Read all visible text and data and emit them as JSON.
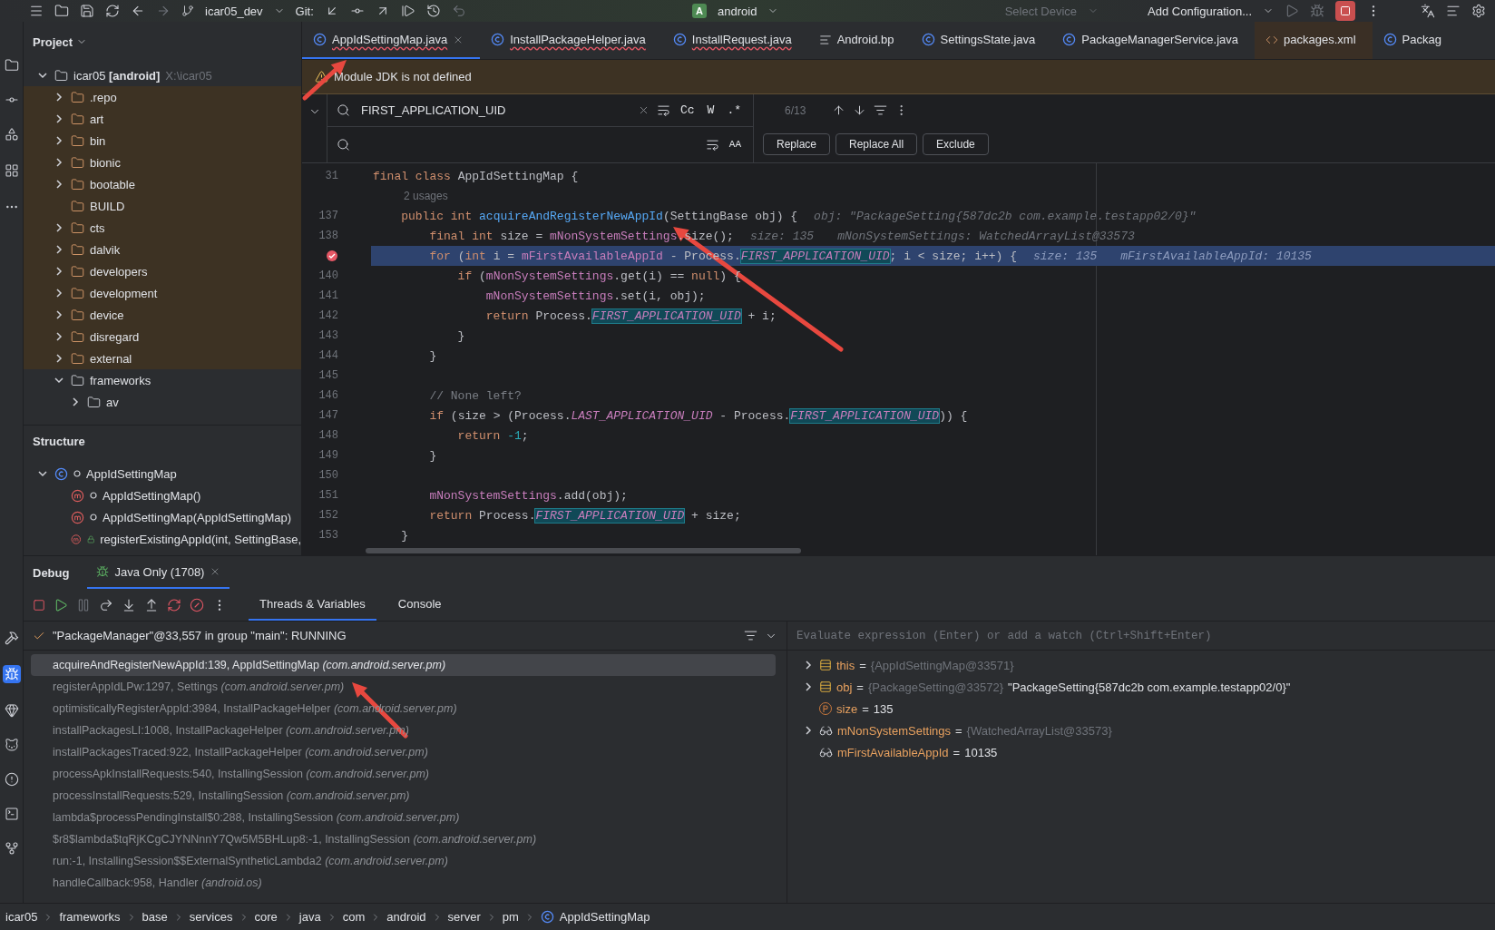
{
  "toolbar": {
    "branch": "icar05_dev",
    "vcs_label": "Git:",
    "project_badge": "A",
    "project": "android",
    "device": {
      "label": "Select Device",
      "disabled": true
    },
    "run_config": "Add Configuration..."
  },
  "project_panel": {
    "title": "Project",
    "root": {
      "label": "icar05 **[android]**",
      "path": "X:\\icar05",
      "expanded": true,
      "children": [
        {
          "label": ".repo",
          "expanded": false,
          "leaf": false,
          "highlighted": true
        },
        {
          "label": "art",
          "expanded": false,
          "leaf": false,
          "highlighted": true
        },
        {
          "label": "bin",
          "expanded": false,
          "leaf": false,
          "highlighted": true
        },
        {
          "label": "bionic",
          "expanded": false,
          "leaf": false,
          "highlighted": true
        },
        {
          "label": "bootable",
          "expanded": false,
          "leaf": false,
          "highlighted": true
        },
        {
          "label": "BUILD",
          "expanded": false,
          "leaf": true,
          "highlighted": true
        },
        {
          "label": "cts",
          "expanded": false,
          "leaf": false,
          "highlighted": true
        },
        {
          "label": "dalvik",
          "expanded": false,
          "leaf": false,
          "highlighted": true
        },
        {
          "label": "developers",
          "expanded": false,
          "leaf": false,
          "highlighted": true
        },
        {
          "label": "development",
          "expanded": false,
          "leaf": false,
          "highlighted": true
        },
        {
          "label": "device",
          "expanded": false,
          "leaf": false,
          "highlighted": true
        },
        {
          "label": "disregard",
          "expanded": false,
          "leaf": false,
          "highlighted": true
        },
        {
          "label": "external",
          "expanded": false,
          "leaf": false,
          "highlighted": true
        },
        {
          "label": "frameworks",
          "expanded": true,
          "leaf": false,
          "highlighted": false,
          "children": [
            {
              "label": "av",
              "expanded": false,
              "leaf": false,
              "highlighted": false
            }
          ]
        }
      ]
    }
  },
  "structure_panel": {
    "title": "Structure",
    "root": {
      "label": "AppIdSettingMap",
      "expanded": true,
      "children": [
        {
          "label": "AppIdSettingMap()",
          "kind": "package_method"
        },
        {
          "label": "AppIdSettingMap(AppIdSettingMap)",
          "kind": "package_method"
        },
        {
          "label": "registerExistingAppId(int, SettingBase,",
          "kind": "protected_method"
        }
      ]
    }
  },
  "editor": {
    "tabs": [
      {
        "label": "AppIdSettingMap.java",
        "kind": "java",
        "selected": true,
        "error": true,
        "highlighted": false
      },
      {
        "label": "InstallPackageHelper.java",
        "kind": "java",
        "selected": false,
        "error": true,
        "highlighted": false
      },
      {
        "label": "InstallRequest.java",
        "kind": "java",
        "selected": false,
        "error": true,
        "highlighted": false
      },
      {
        "label": "Android.bp",
        "kind": "text",
        "selected": false,
        "error": false,
        "highlighted": false
      },
      {
        "label": "SettingsState.java",
        "kind": "java",
        "selected": false,
        "error": false,
        "highlighted": false
      },
      {
        "label": "PackageManagerService.java",
        "kind": "java",
        "selected": false,
        "error": false,
        "highlighted": false
      },
      {
        "label": "packages.xml",
        "kind": "xml",
        "selected": false,
        "error": false,
        "highlighted": true
      },
      {
        "label": "Packag",
        "kind": "java",
        "selected": false,
        "error": false,
        "highlighted": false
      }
    ],
    "notification": "Module JDK is not defined",
    "find": {
      "query": "FIRST_APPLICATION_UID",
      "options": [
        {
          "label": "Cc",
          "selected": false
        },
        {
          "label": "W",
          "selected": false
        },
        {
          "label": ".*",
          "selected": false
        }
      ],
      "count": "6/13",
      "preserve_case": "AA",
      "buttons": [
        "Replace",
        "Replace All",
        "Exclude"
      ]
    },
    "lines": [
      {
        "kind": "code",
        "number": "31",
        "current": false,
        "breakpoint": false,
        "segments": [
          {
            "kind": "keyword",
            "text": "final class "
          },
          {
            "kind": "plain",
            "text": "AppIdSettingMap {"
          }
        ]
      },
      {
        "kind": "usages",
        "text": "2 usages"
      },
      {
        "kind": "code",
        "number": "137",
        "current": false,
        "breakpoint": false,
        "segments": [
          {
            "kind": "keyword",
            "text": "    public int "
          },
          {
            "kind": "method",
            "text": "acquireAndRegisterNewAppId"
          },
          {
            "kind": "plain",
            "text": "(SettingBase obj) {"
          }
        ],
        "hints": [
          "obj: \"PackageSetting{587dc2b com.example.testapp02/0}\""
        ]
      },
      {
        "kind": "code",
        "number": "138",
        "current": false,
        "breakpoint": false,
        "segments": [
          {
            "kind": "keyword",
            "text": "        final int "
          },
          {
            "kind": "plain",
            "text": "size = "
          },
          {
            "kind": "field",
            "text": "mNonSystemSettings"
          },
          {
            "kind": "plain",
            "text": ".size();"
          }
        ],
        "hints": [
          "size: 135",
          "mNonSystemSettings: WatchedArrayList@33573"
        ]
      },
      {
        "kind": "code",
        "current": true,
        "breakpoint": true,
        "segments": [
          {
            "kind": "keyword",
            "text": "        for "
          },
          {
            "kind": "plain",
            "text": "("
          },
          {
            "kind": "keyword",
            "text": "int "
          },
          {
            "kind": "plain",
            "text": "i = "
          },
          {
            "kind": "field",
            "text": "mFirstAvailableAppId"
          },
          {
            "kind": "plain",
            "text": " - Process."
          },
          {
            "kind": "match",
            "text": "FIRST_APPLICATION_UID"
          },
          {
            "kind": "plain",
            "text": "; i < size; i++) {"
          }
        ],
        "hints": [
          "size: 135",
          "mFirstAvailableAppId: 10135"
        ]
      },
      {
        "kind": "code",
        "number": "140",
        "current": false,
        "breakpoint": false,
        "segments": [
          {
            "kind": "keyword",
            "text": "            if "
          },
          {
            "kind": "plain",
            "text": "("
          },
          {
            "kind": "field",
            "text": "mNonSystemSettings"
          },
          {
            "kind": "plain",
            "text": ".get(i) == "
          },
          {
            "kind": "keyword",
            "text": "null"
          },
          {
            "kind": "plain",
            "text": ") {"
          }
        ]
      },
      {
        "kind": "code",
        "number": "141",
        "current": false,
        "breakpoint": false,
        "segments": [
          {
            "kind": "field",
            "text": "                mNonSystemSettings"
          },
          {
            "kind": "plain",
            "text": ".set(i, obj);"
          }
        ]
      },
      {
        "kind": "code",
        "number": "142",
        "current": false,
        "breakpoint": false,
        "segments": [
          {
            "kind": "keyword",
            "text": "                return "
          },
          {
            "kind": "plain",
            "text": "Process."
          },
          {
            "kind": "match",
            "text": "FIRST_APPLICATION_UID"
          },
          {
            "kind": "plain",
            "text": " + i;"
          }
        ]
      },
      {
        "kind": "code",
        "number": "143",
        "current": false,
        "breakpoint": false,
        "segments": [
          {
            "kind": "plain",
            "text": "            }"
          }
        ]
      },
      {
        "kind": "code",
        "number": "144",
        "current": false,
        "breakpoint": false,
        "segments": [
          {
            "kind": "plain",
            "text": "        }"
          }
        ]
      },
      {
        "kind": "code",
        "number": "145",
        "current": false,
        "breakpoint": false
      },
      {
        "kind": "code",
        "number": "146",
        "current": false,
        "breakpoint": false,
        "segments": [
          {
            "kind": "comment",
            "text": "        // None left?"
          }
        ]
      },
      {
        "kind": "code",
        "number": "147",
        "current": false,
        "breakpoint": false,
        "segments": [
          {
            "kind": "keyword",
            "text": "        if "
          },
          {
            "kind": "plain",
            "text": "(size > (Process."
          },
          {
            "kind": "constant",
            "text": "LAST_APPLICATION_UID"
          },
          {
            "kind": "plain",
            "text": " - Process."
          },
          {
            "kind": "match",
            "text": "FIRST_APPLICATION_UID"
          },
          {
            "kind": "plain",
            "text": ")) {"
          }
        ]
      },
      {
        "kind": "code",
        "number": "148",
        "current": false,
        "breakpoint": false,
        "segments": [
          {
            "kind": "keyword",
            "text": "            return "
          },
          {
            "kind": "number",
            "text": "-1"
          },
          {
            "kind": "plain",
            "text": ";"
          }
        ]
      },
      {
        "kind": "code",
        "number": "149",
        "current": false,
        "breakpoint": false,
        "segments": [
          {
            "kind": "plain",
            "text": "        }"
          }
        ]
      },
      {
        "kind": "code",
        "number": "150",
        "current": false,
        "breakpoint": false
      },
      {
        "kind": "code",
        "number": "151",
        "current": false,
        "breakpoint": false,
        "segments": [
          {
            "kind": "field",
            "text": "        mNonSystemSettings"
          },
          {
            "kind": "plain",
            "text": ".add(obj);"
          }
        ]
      },
      {
        "kind": "code",
        "number": "152",
        "current": false,
        "breakpoint": false,
        "segments": [
          {
            "kind": "keyword",
            "text": "        return "
          },
          {
            "kind": "plain",
            "text": "Process."
          },
          {
            "kind": "match",
            "text": "FIRST_APPLICATION_UID"
          },
          {
            "kind": "plain",
            "text": " + size;"
          }
        ]
      },
      {
        "kind": "code",
        "number": "153",
        "current": false,
        "breakpoint": false,
        "segments": [
          {
            "kind": "plain",
            "text": "    }"
          }
        ]
      }
    ]
  },
  "debug": {
    "title": "Debug",
    "sessions": [
      {
        "label": "Java Only (1708)",
        "selected": true
      }
    ],
    "tabs": [
      {
        "label": "Threads & Variables",
        "selected": true
      },
      {
        "label": "Console",
        "selected": false
      }
    ],
    "thread": "\"PackageManager\"@33,557 in group \"main\": RUNNING",
    "frames": [
      {
        "text": "acquireAndRegisterNewAppId:139, AppIdSettingMap *(com.android.server.pm)*",
        "selected": true
      },
      {
        "text": "registerAppIdLPw:1297, Settings *(com.android.server.pm)*",
        "selected": false
      },
      {
        "text": "optimisticallyRegisterAppId:3984, InstallPackageHelper *(com.android.server.pm)*",
        "selected": false
      },
      {
        "text": "installPackagesLI:1008, InstallPackageHelper *(com.android.server.pm)*",
        "selected": false
      },
      {
        "text": "installPackagesTraced:922, InstallPackageHelper *(com.android.server.pm)*",
        "selected": false
      },
      {
        "text": "processApkInstallRequests:540, InstallingSession *(com.android.server.pm)*",
        "selected": false
      },
      {
        "text": "processInstallRequests:529, InstallingSession *(com.android.server.pm)*",
        "selected": false
      },
      {
        "text": "lambda$processPendingInstall$0:288, InstallingSession *(com.android.server.pm)*",
        "selected": false
      },
      {
        "text": "$r8$lambda$tqRjKCgCJYNNnnY7Qw5M5BHLup8:-1, InstallingSession *(com.android.server.pm)*",
        "selected": false
      },
      {
        "text": "run:-1, InstallingSession$$ExternalSyntheticLambda2 *(com.android.server.pm)*",
        "selected": false
      },
      {
        "text": "handleCallback:958, Handler *(android.os)*",
        "selected": false
      }
    ],
    "evaluate_placeholder": "Evaluate expression (Enter) or add a watch (Ctrl+Shift+Enter)",
    "variables": [
      {
        "kind": "object",
        "name": "this",
        "op": "=",
        "ref": "{AppIdSettingMap@33571}",
        "expanded": false
      },
      {
        "kind": "object",
        "name": "obj",
        "op": "=",
        "ref": "{PackageSetting@33572}",
        "value": "\"PackageSetting{587dc2b com.example.testapp02/0}\"",
        "expanded": false
      },
      {
        "kind": "primitive",
        "name": "size",
        "op": "=",
        "value": "135"
      },
      {
        "kind": "field",
        "name": "mNonSystemSettings",
        "op": "=",
        "ref": "{WatchedArrayList@33573}",
        "expanded": false
      },
      {
        "kind": "field_value",
        "name": "mFirstAvailableAppId",
        "op": "=",
        "value": "10135"
      }
    ]
  },
  "breadcrumb": [
    "icar05",
    "frameworks",
    "base",
    "services",
    "core",
    "java",
    "com",
    "android",
    "server",
    "pm",
    "AppIdSettingMap"
  ]
}
